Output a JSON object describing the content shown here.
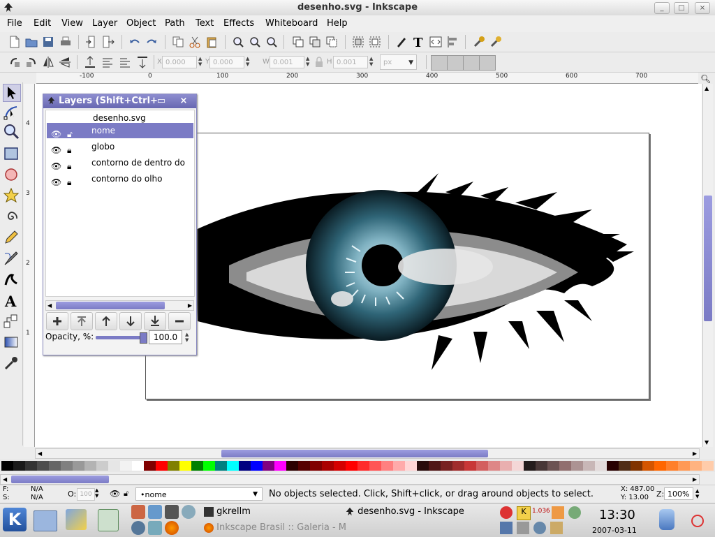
{
  "window": {
    "title": "desenho.svg - Inkscape",
    "controls": [
      "_",
      "□",
      "×"
    ]
  },
  "menu": [
    "File",
    "Edit",
    "View",
    "Layer",
    "Object",
    "Path",
    "Text",
    "Effects",
    "Whiteboard",
    "Help"
  ],
  "coords_toolbar": {
    "x_label": "X",
    "x_value": "0.000",
    "y_label": "Y",
    "y_value": "0.000",
    "w_label": "W",
    "w_value": "0.001",
    "h_label": "H",
    "h_value": "0.001",
    "unit": "px"
  },
  "rulers": {
    "horizontal": [
      "-100",
      "0",
      "100",
      "200",
      "300",
      "400",
      "500",
      "600",
      "700"
    ],
    "vertical": [
      "4",
      "3",
      "2",
      "1"
    ]
  },
  "layers_dialog": {
    "title": "Layers (Shift+Ctrl+",
    "document": "desenho.svg",
    "rows": [
      {
        "name": "nome",
        "selected": true
      },
      {
        "name": "globo",
        "selected": false
      },
      {
        "name": "contorno de dentro do",
        "selected": false
      },
      {
        "name": "contorno do olho",
        "selected": false
      }
    ],
    "opacity_label": "Opacity, %:",
    "opacity_value": "100.0",
    "opacity_level": 1.0
  },
  "palette_colors": [
    "#000000",
    "#1a1a1a",
    "#333333",
    "#4d4d4d",
    "#666666",
    "#808080",
    "#999999",
    "#b3b3b3",
    "#cccccc",
    "#e6e6e6",
    "#f2f2f2",
    "#ffffff",
    "#800000",
    "#ff0000",
    "#808000",
    "#ffff00",
    "#008000",
    "#00ff00",
    "#008080",
    "#00ffff",
    "#000080",
    "#0000ff",
    "#800080",
    "#ff00ff",
    "#2b0000",
    "#550000",
    "#800000",
    "#aa0000",
    "#d40000",
    "#ff0000",
    "#ff2a2a",
    "#ff5555",
    "#ff8080",
    "#ffaaaa",
    "#ffd5d5",
    "#280b0b",
    "#501616",
    "#782121",
    "#a02c2c",
    "#c83737",
    "#d35f5f",
    "#de8787",
    "#e9afaf",
    "#f4d7d7",
    "#241c1c",
    "#483737",
    "#6c5353",
    "#916f6f",
    "#ac9393",
    "#c8b7b7",
    "#e3dbdb",
    "#280000",
    "#502d16",
    "#803300",
    "#d45500",
    "#ff6600",
    "#ff7f2a",
    "#ff9955",
    "#ffb380",
    "#ffccaa"
  ],
  "status": {
    "fill_label": "F:",
    "fill_value": "N/A",
    "stroke_label": "S:",
    "stroke_value": "N/A",
    "opacity_label": "O:",
    "opacity_value": "100",
    "layer": "•nome",
    "message": "No objects selected. Click, Shift+click, or drag around objects to select.",
    "x_readout": "X: 487.00",
    "y_readout": "Y: 13.00",
    "zoom_label": "Z:",
    "zoom_value": "100%"
  },
  "taskbar": {
    "tasks": [
      {
        "label": "gkrellm"
      },
      {
        "label": "desenho.svg - Inkscape"
      },
      {
        "label": "Inkscape Brasil :: Galeria - M"
      }
    ],
    "tray_value": "1.036",
    "clock_time": "13:30",
    "clock_date": "2007-03-11"
  }
}
